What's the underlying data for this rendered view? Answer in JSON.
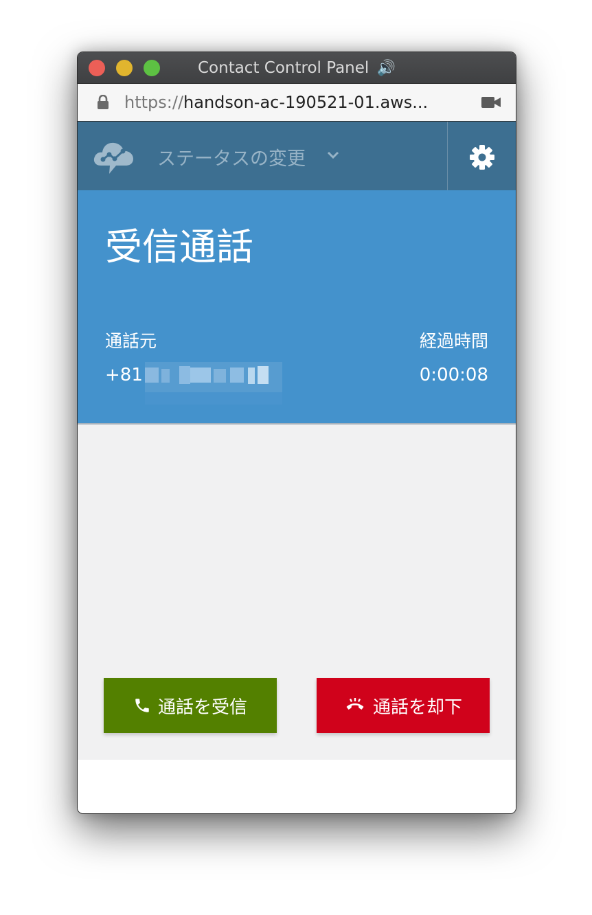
{
  "window": {
    "title": "Contact Control Panel",
    "speaker_icon": "🔊"
  },
  "address_bar": {
    "url_scheme": "https://",
    "url_host": "handson-ac-190521-01.aws..."
  },
  "header": {
    "status_label": "ステータスの変更"
  },
  "call": {
    "heading": "受信通話",
    "caller_label": "通話元",
    "caller_number_prefix": "+81",
    "elapsed_label": "経過時間",
    "elapsed_value": "0:00:08"
  },
  "actions": {
    "accept_label": "通話を受信",
    "reject_label": "通話を却下"
  },
  "colors": {
    "header_bg": "#3d6f91",
    "call_panel_bg": "#4492cc",
    "accept_button": "#538000",
    "reject_button": "#d0021b"
  },
  "icons": {
    "lock": "lock-icon",
    "camera": "video-camera-icon",
    "logo": "cloud-chat-logo-icon",
    "chevron": "chevron-down-icon",
    "settings": "gear-icon",
    "accept": "phone-icon",
    "reject": "hang-up-icon"
  }
}
